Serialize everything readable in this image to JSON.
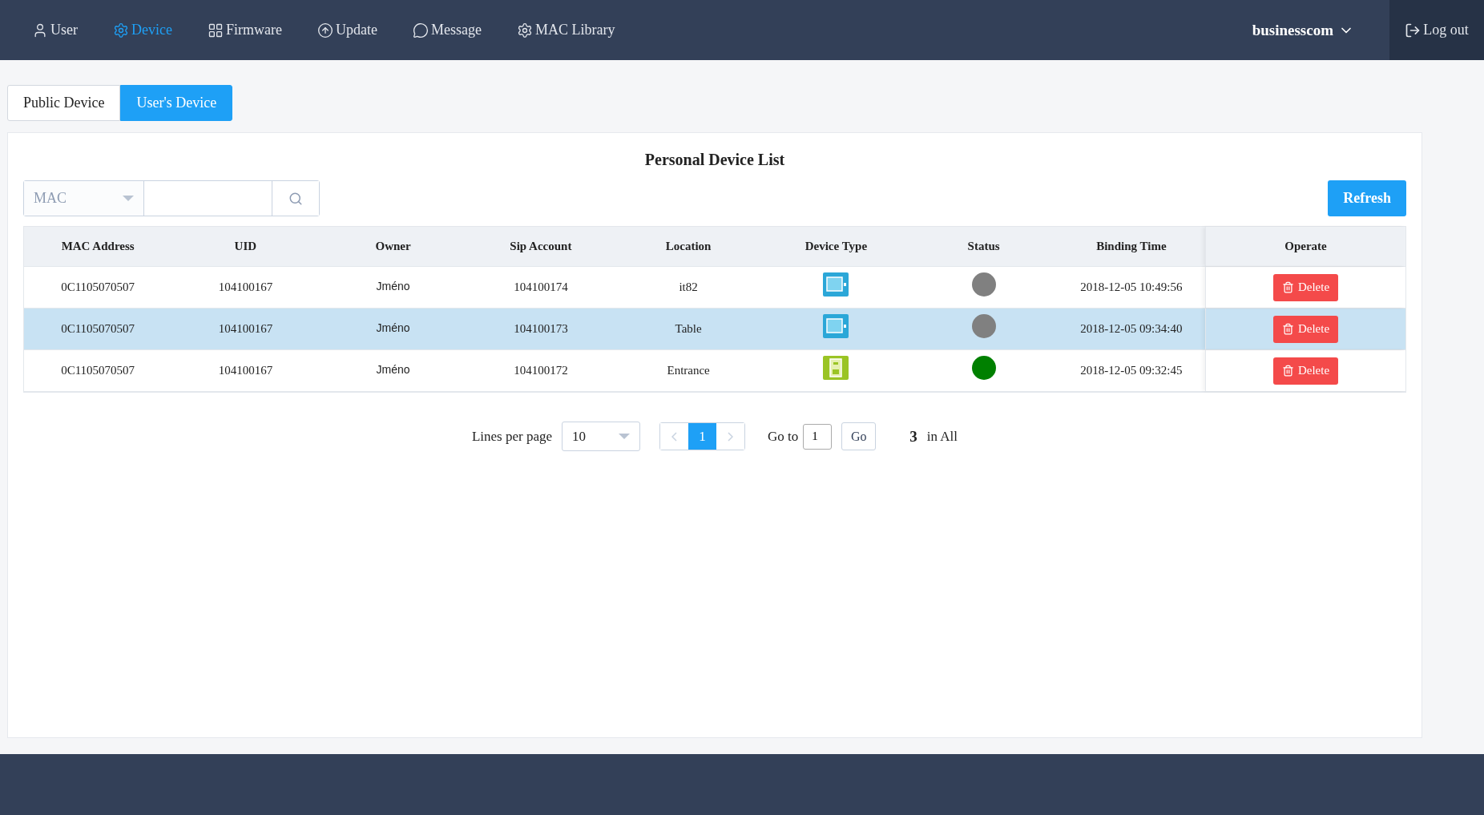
{
  "nav": {
    "items": [
      {
        "label": "User",
        "selected": false
      },
      {
        "label": "Device",
        "selected": true
      },
      {
        "label": "Firmware",
        "selected": false
      },
      {
        "label": "Update",
        "selected": false
      },
      {
        "label": "Message",
        "selected": false
      },
      {
        "label": "MAC Library",
        "selected": false
      }
    ],
    "account": "businesscom",
    "logout": "Log out"
  },
  "tabs": [
    {
      "label": "Public Device",
      "selected": false
    },
    {
      "label": "User's Device",
      "selected": true
    }
  ],
  "title": "Personal Device List",
  "filter": {
    "field": "MAC",
    "refresh": "Refresh"
  },
  "table": {
    "columns": [
      "MAC Address",
      "UID",
      "Owner",
      "Sip Account",
      "Location",
      "Device Type",
      "Status",
      "Binding Time",
      "Operate"
    ],
    "rows": [
      {
        "mac": "0C1105070507",
        "uid": "104100167",
        "owner": "Jméno",
        "sip": "104100174",
        "location": "it82",
        "kind": "screen",
        "color": "#808080",
        "time": "2018-12-05 10:49:56",
        "action": "Delete",
        "selected": false
      },
      {
        "mac": "0C1105070507",
        "uid": "104100167",
        "owner": "Jméno",
        "sip": "104100173",
        "location": "Table",
        "kind": "screen",
        "color": "#808080",
        "time": "2018-12-05 09:34:40",
        "action": "Delete",
        "selected": true
      },
      {
        "mac": "0C1105070507",
        "uid": "104100167",
        "owner": "Jméno",
        "sip": "104100172",
        "location": "Entrance",
        "kind": "door",
        "color": "#008000",
        "time": "2018-12-05 09:32:45",
        "action": "Delete",
        "selected": false
      }
    ]
  },
  "pagination": {
    "lines_label": "Lines per page",
    "lines": "10",
    "pages": [
      {
        "label": "1",
        "selected": true
      }
    ],
    "goto_label": "Go to",
    "goto_value": "1",
    "go": "Go",
    "total": "3",
    "total_label": "in All"
  }
}
